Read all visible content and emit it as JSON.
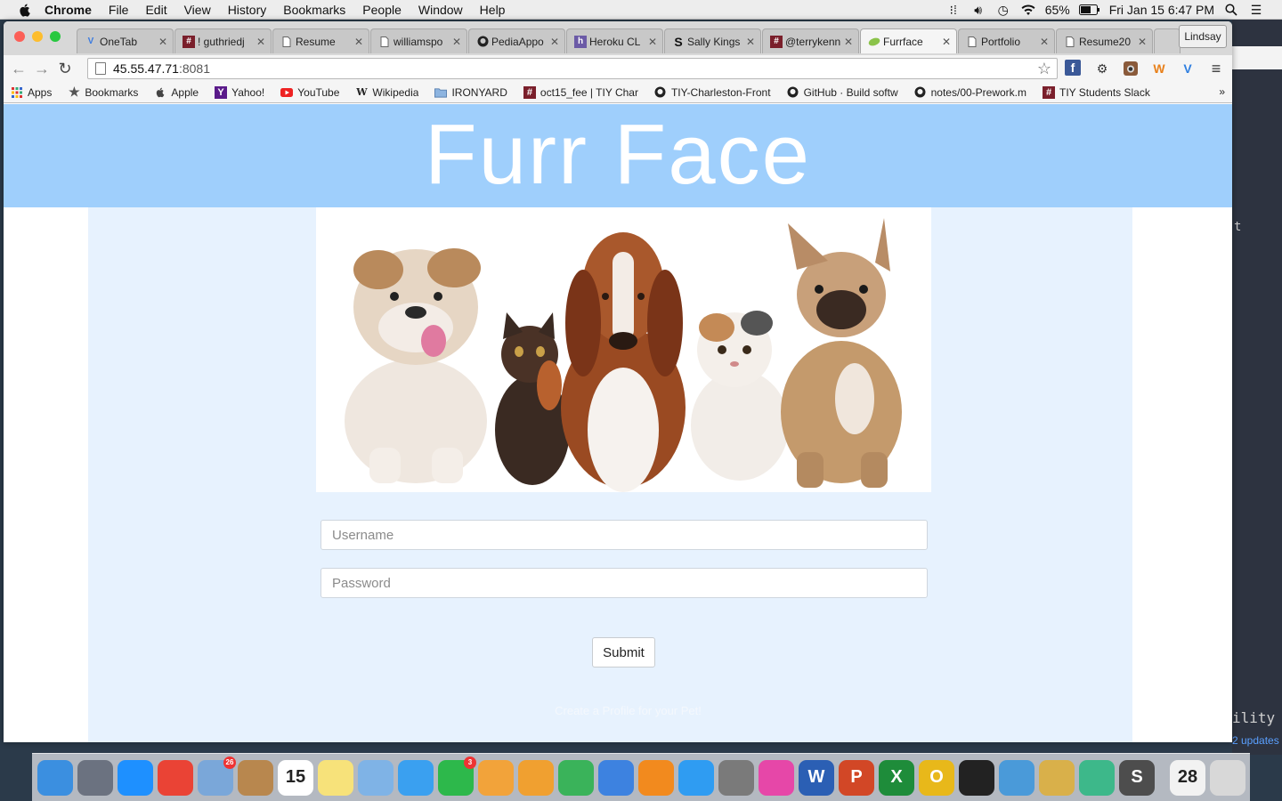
{
  "menubar": {
    "app": "Chrome",
    "menus": [
      "File",
      "Edit",
      "View",
      "History",
      "Bookmarks",
      "People",
      "Window",
      "Help"
    ],
    "battery": "65%",
    "clock": "Fri Jan 15  6:47 PM"
  },
  "browser": {
    "tabs": [
      {
        "title": "OneTab",
        "icon": "onetab-icon",
        "active": false
      },
      {
        "title": "! guthriedj",
        "icon": "slack-icon",
        "active": false
      },
      {
        "title": "Resume",
        "icon": "page-icon",
        "active": false
      },
      {
        "title": "williamspo",
        "icon": "page-icon",
        "active": false
      },
      {
        "title": "PediaAppo",
        "icon": "github-icon",
        "active": false
      },
      {
        "title": "Heroku CL",
        "icon": "heroku-icon",
        "active": false
      },
      {
        "title": "Sally Kings",
        "icon": "scribd-icon",
        "active": false
      },
      {
        "title": "@terrykenn",
        "icon": "slack-icon",
        "active": false
      },
      {
        "title": "Furrface",
        "icon": "leaf-icon",
        "active": true
      },
      {
        "title": "Portfolio",
        "icon": "page-icon",
        "active": false
      },
      {
        "title": "Resume20",
        "icon": "page-icon",
        "active": false
      }
    ],
    "profile": "Lindsay",
    "url": {
      "host": "45.55.47.71",
      "port": ":8081"
    },
    "bookmarks": [
      {
        "label": "Apps",
        "icon": "apps-grid-icon"
      },
      {
        "label": "Bookmarks",
        "icon": "star-icon"
      },
      {
        "label": "Apple",
        "icon": "apple-icon"
      },
      {
        "label": "Yahoo!",
        "icon": "yahoo-icon"
      },
      {
        "label": "YouTube",
        "icon": "youtube-icon"
      },
      {
        "label": "Wikipedia",
        "icon": "wikipedia-icon"
      },
      {
        "label": "IRONYARD",
        "icon": "folder-icon"
      },
      {
        "label": "oct15_fee | TIY Char",
        "icon": "slack-icon"
      },
      {
        "label": "TIY-Charleston-Front",
        "icon": "github-icon"
      },
      {
        "label": "GitHub · Build softw",
        "icon": "github-icon"
      },
      {
        "label": "notes/00-Prework.m",
        "icon": "github-icon"
      },
      {
        "label": "TIY Students Slack",
        "icon": "slack-icon"
      }
    ],
    "bookmarks_more": "»"
  },
  "page": {
    "title": "Furr Face",
    "username_placeholder": "Username",
    "password_placeholder": "Password",
    "submit_label": "Submit",
    "create_link": "Create a Profile for your Pet!"
  },
  "desktop": {
    "editor_char": "t",
    "editor_text": "ility",
    "updates": "2 updates"
  },
  "dock": {
    "apps": [
      {
        "name": "finder",
        "color": "#3b8fe0"
      },
      {
        "name": "launchpad",
        "color": "#6b7280"
      },
      {
        "name": "safari",
        "color": "#1e90ff"
      },
      {
        "name": "chrome",
        "color": "#ea4335"
      },
      {
        "name": "mail",
        "color": "#7aa7d9",
        "badge": "26"
      },
      {
        "name": "contacts",
        "color": "#b8874e"
      },
      {
        "name": "calendar",
        "color": "#ffffff",
        "text": "15"
      },
      {
        "name": "notes",
        "color": "#f7e27a"
      },
      {
        "name": "preview",
        "color": "#7fb3e6"
      },
      {
        "name": "messages",
        "color": "#3aa0f0"
      },
      {
        "name": "facetime",
        "color": "#2db84b",
        "badge": "3"
      },
      {
        "name": "photos",
        "color": "#f2a33a"
      },
      {
        "name": "pages",
        "color": "#f0a030"
      },
      {
        "name": "numbers",
        "color": "#3ab35a"
      },
      {
        "name": "keynote",
        "color": "#3d82e0"
      },
      {
        "name": "ibooks",
        "color": "#f28a1e"
      },
      {
        "name": "app-store",
        "color": "#2f9cf2"
      },
      {
        "name": "system-preferences",
        "color": "#7a7a7a"
      },
      {
        "name": "itunes",
        "color": "#e647a8"
      },
      {
        "name": "word",
        "color": "#2b5fb4",
        "text": "W"
      },
      {
        "name": "powerpoint",
        "color": "#d24726",
        "text": "P"
      },
      {
        "name": "excel",
        "color": "#1e8c3a",
        "text": "X"
      },
      {
        "name": "outlook",
        "color": "#e8b81a",
        "text": "O"
      },
      {
        "name": "terminal",
        "color": "#222222"
      },
      {
        "name": "network-utility",
        "color": "#4a9ad9"
      },
      {
        "name": "sequel",
        "color": "#d9b04a"
      },
      {
        "name": "atom",
        "color": "#3db88a"
      },
      {
        "name": "sublime",
        "color": "#4d4d4d",
        "text": "S"
      }
    ],
    "trailing": [
      {
        "name": "ical-doc",
        "color": "#f2f2f2",
        "text": "28"
      },
      {
        "name": "trash",
        "color": "#d8d8d8"
      }
    ]
  }
}
